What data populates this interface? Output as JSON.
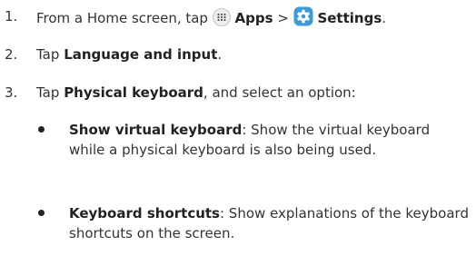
{
  "steps": [
    {
      "number": "1.",
      "prefix": "From a Home screen, tap",
      "apps_label": "Apps",
      "separator": ">",
      "settings_label": "Settings",
      "end": "."
    },
    {
      "number": "2.",
      "prefix": "Tap",
      "bold": "Language and input",
      "end": "."
    },
    {
      "number": "3.",
      "prefix": "Tap",
      "bold": "Physical keyboard",
      "end": ", and select an option:"
    }
  ],
  "options": [
    {
      "title": "Show virtual keyboard",
      "description": ": Show the virtual keyboard while a physical keyboard is also being used."
    },
    {
      "title": "Keyboard shortcuts",
      "description": ": Show explanations of the keyboard shortcuts on the screen."
    }
  ],
  "icons": {
    "apps": "apps-grid-icon",
    "settings": "settings-gear-icon"
  },
  "colors": {
    "text": "#333333",
    "settings_icon_bg": "#3f9ad6",
    "apps_icon_bg": "#eeeeee"
  }
}
